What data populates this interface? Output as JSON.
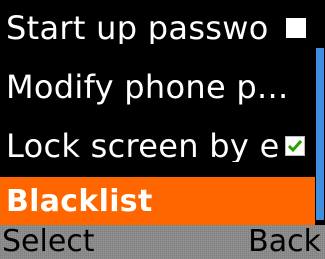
{
  "menu": {
    "items": [
      {
        "label": "Start up passwo",
        "trailing": "toggle-square-icon"
      },
      {
        "label": "Modify phone p...",
        "trailing": null
      },
      {
        "label": "Lock screen by e",
        "trailing": "checkbox-checked-icon"
      },
      {
        "label": "Blacklist",
        "trailing": null,
        "selected": true
      }
    ]
  },
  "softkeys": {
    "left": "Select",
    "right": "Back"
  },
  "colors": {
    "selection": "#ff6600",
    "scroll_thumb": "#3f8fe0",
    "checkmark": "#2aa000"
  }
}
